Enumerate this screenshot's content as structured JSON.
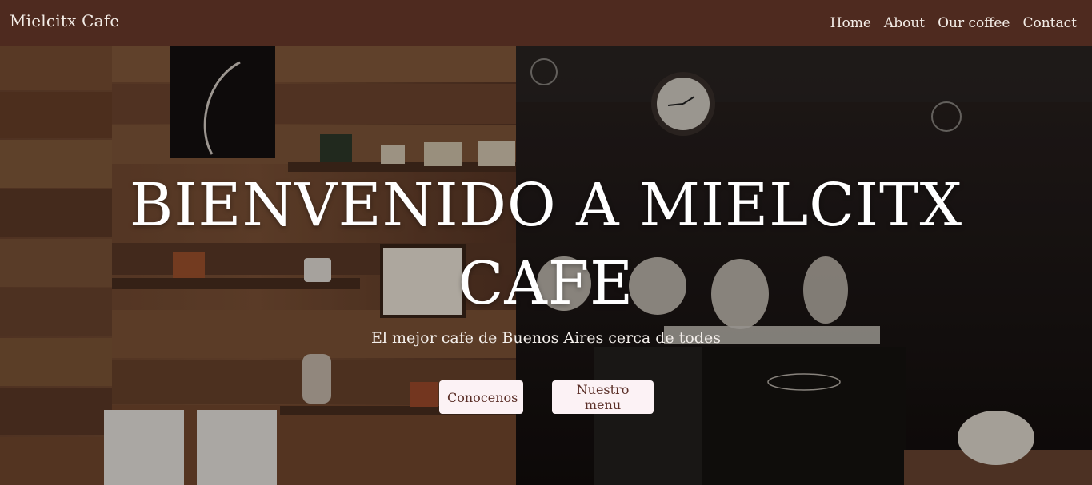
{
  "navbar": {
    "brand": "Mielcitx Cafe",
    "links": [
      "Home",
      "About",
      "Our coffee",
      "Contact"
    ]
  },
  "hero": {
    "title": "BIENVENIDO A MIELCITX CAFE",
    "subtitle": "El mejor cafe de Buenos Aires cerca de todes",
    "buttons": [
      "Conocenos",
      "Nuestro menu"
    ]
  },
  "colors": {
    "navbar_bg": "#4e2a1f",
    "button_bg": "#fcf2f5",
    "button_text": "#5a2e27"
  }
}
